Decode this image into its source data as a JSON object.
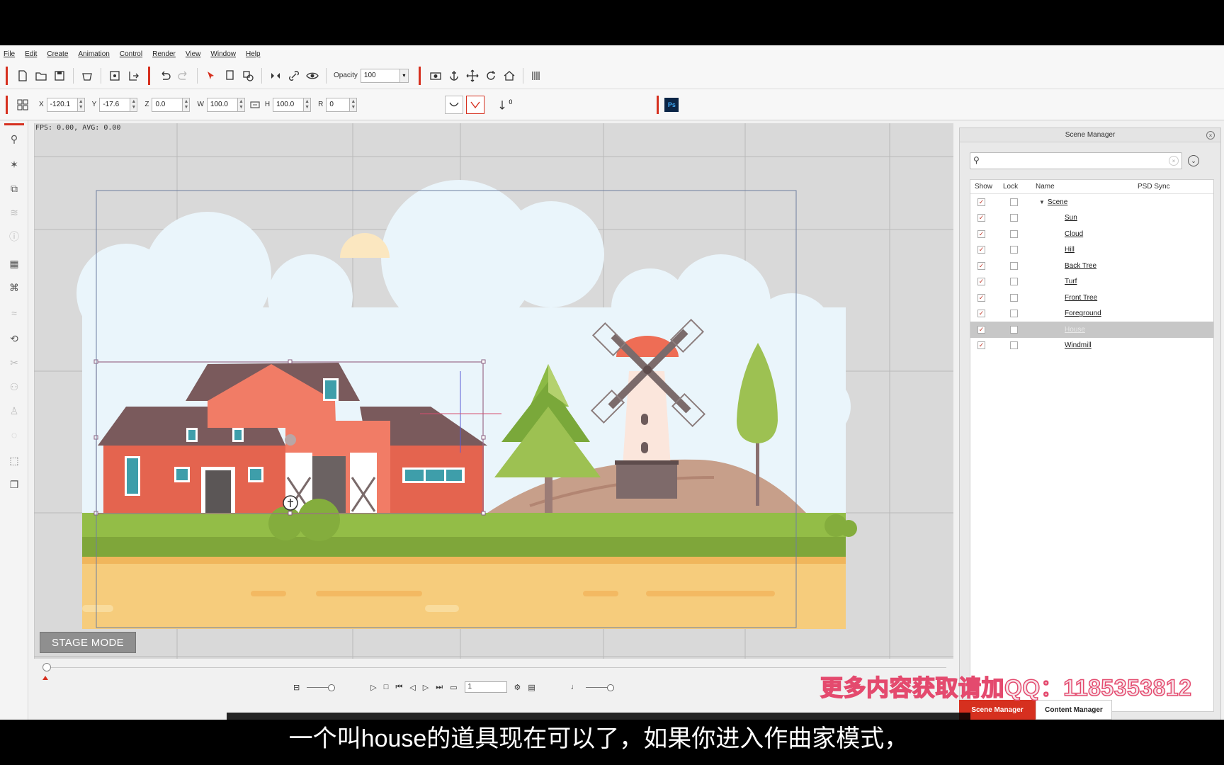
{
  "menu": [
    "File",
    "Edit",
    "Create",
    "Animation",
    "Control",
    "Render",
    "View",
    "Window",
    "Help"
  ],
  "toolbar": {
    "opacity_label": "Opacity",
    "opacity_value": "100"
  },
  "transform": {
    "x_label": "X",
    "x_value": "-120.1",
    "y_label": "Y",
    "y_value": "-17.6",
    "z_label": "Z",
    "z_value": "0.0",
    "w_label": "W",
    "w_value": "100.0",
    "h_label": "H",
    "h_value": "100.0",
    "r_label": "R",
    "r_value": "0",
    "flip_label": "0",
    "ps_badge": "Ps"
  },
  "canvas": {
    "fps_text": "FPS: 0.00, AVG: 0.00",
    "stage_mode": "STAGE MODE"
  },
  "timeline": {
    "frame_value": "1"
  },
  "scene_manager": {
    "title": "Scene Manager",
    "columns": {
      "show": "Show",
      "lock": "Lock",
      "name": "Name",
      "psd_sync": "PSD Sync"
    },
    "root": "Scene",
    "items": [
      {
        "name": "Sun",
        "selected": false
      },
      {
        "name": "Cloud",
        "selected": false
      },
      {
        "name": "Hill",
        "selected": false
      },
      {
        "name": "Back Tree",
        "selected": false
      },
      {
        "name": "Turf",
        "selected": false
      },
      {
        "name": "Front Tree",
        "selected": false
      },
      {
        "name": "Foreground",
        "selected": false
      },
      {
        "name": "House",
        "selected": true
      },
      {
        "name": "Windmill",
        "selected": false
      }
    ]
  },
  "panel_tabs": {
    "scene": "Scene Manager",
    "content": "Content Manager"
  },
  "overlay": {
    "watermark": "更多内容获取请加QQ：1185353812",
    "subtitle": "一个叫house的道具现在可以了，如果你进入作曲家模式，"
  },
  "colors": {
    "accent": "#d6301f",
    "sky": "#eaf5fb",
    "barn": "#e4644f",
    "grass": "#8ab43f",
    "ground": "#f6cc7c"
  }
}
